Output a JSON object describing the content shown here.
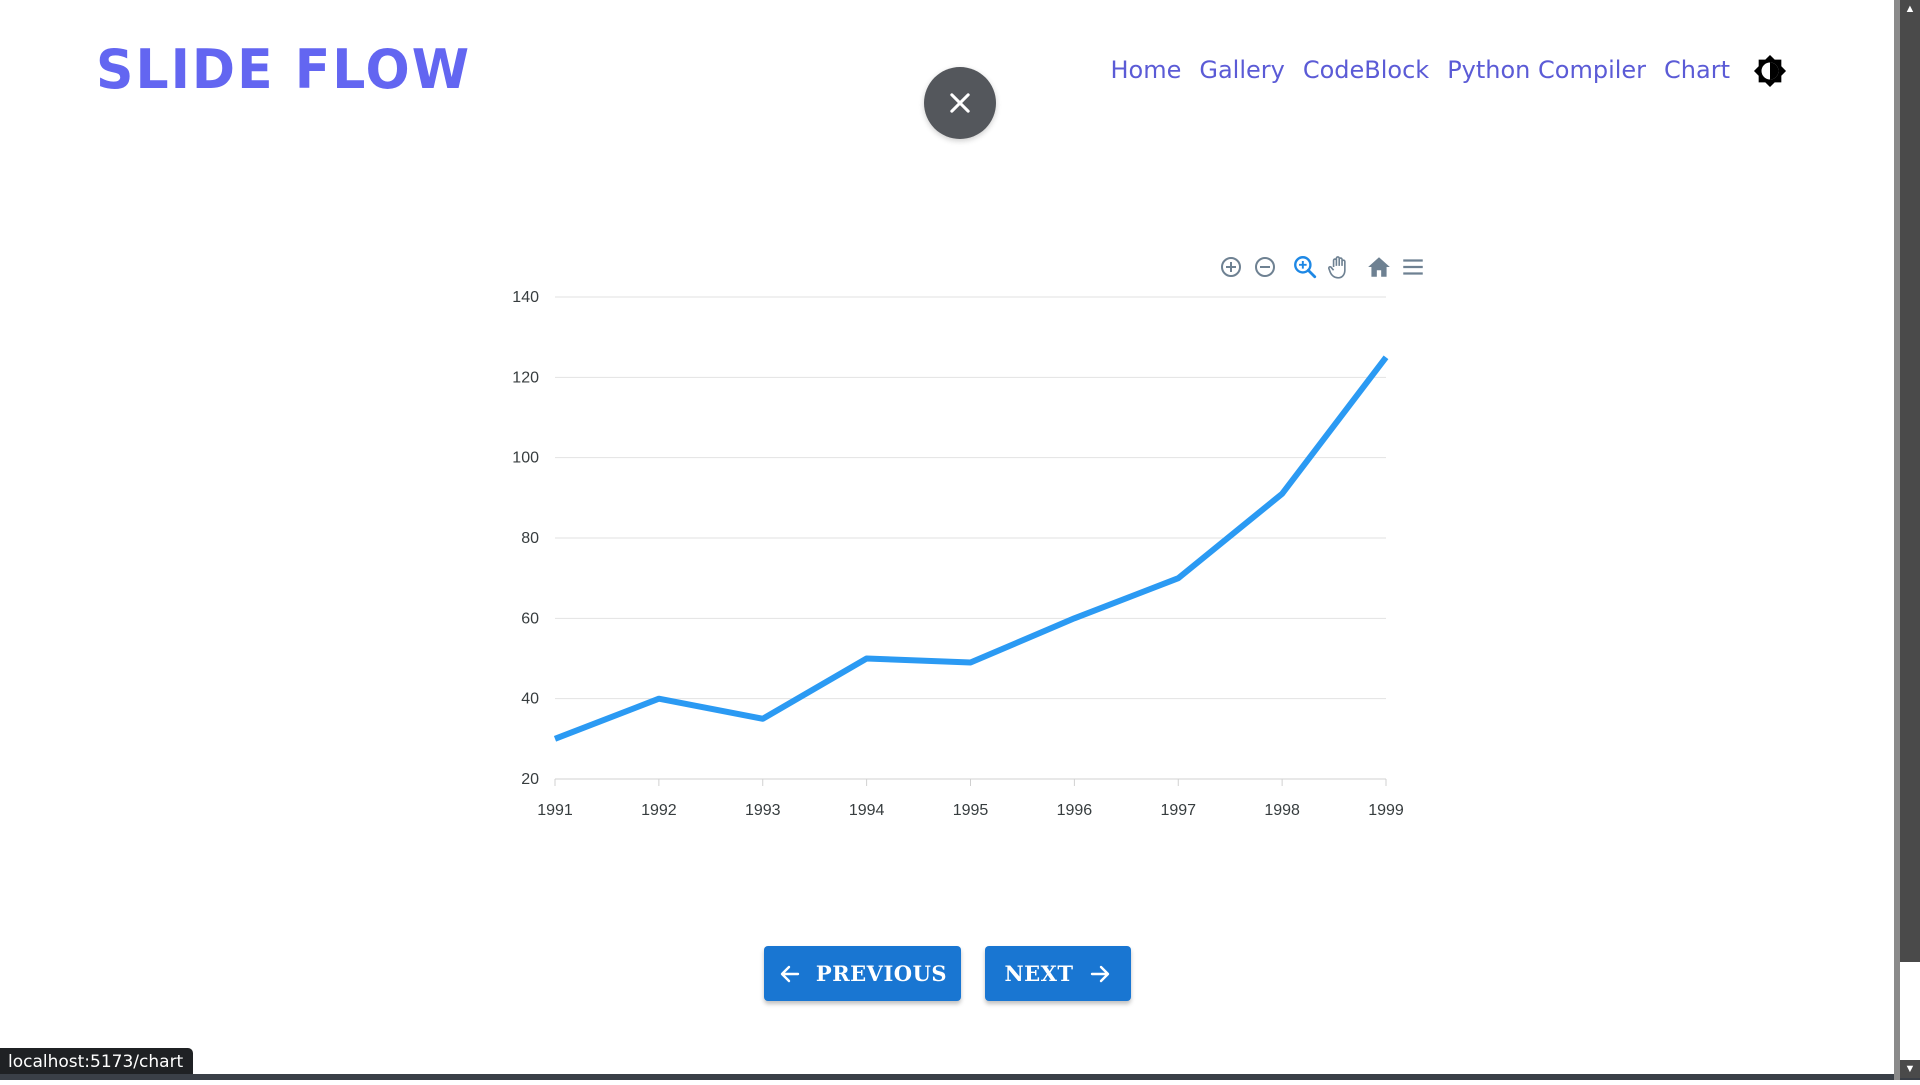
{
  "header": {
    "logo": "SLIDE FLOW",
    "nav": [
      {
        "label": "Home"
      },
      {
        "label": "Gallery"
      },
      {
        "label": "CodeBlock"
      },
      {
        "label": "Python Compiler"
      },
      {
        "label": "Chart"
      }
    ],
    "theme_icon": "brightness-icon"
  },
  "close_icon": "close-icon",
  "toolbar": {
    "icons": [
      "zoom-in-icon",
      "zoom-out-icon",
      "selection-zoom-icon",
      "pan-icon",
      "home-reset-icon",
      "menu-icon"
    ],
    "active": "selection-zoom-icon",
    "active_color": "#1e88e5",
    "inactive_color": "#6e8192"
  },
  "chart_data": {
    "type": "line",
    "x": [
      "1991",
      "1992",
      "1993",
      "1994",
      "1995",
      "1996",
      "1997",
      "1998",
      "1999"
    ],
    "series": [
      {
        "values": [
          30,
          40,
          35,
          50,
          49,
          60,
          70,
          91,
          125
        ],
        "color": "#2b9af3"
      }
    ],
    "yticks": [
      "20",
      "40",
      "60",
      "80",
      "100",
      "120",
      "140"
    ],
    "ylim": [
      20,
      140
    ],
    "grid": true
  },
  "footer": {
    "prev_label": "PREVIOUS",
    "next_label": "NEXT"
  },
  "status_url": "localhost:5173/chart"
}
